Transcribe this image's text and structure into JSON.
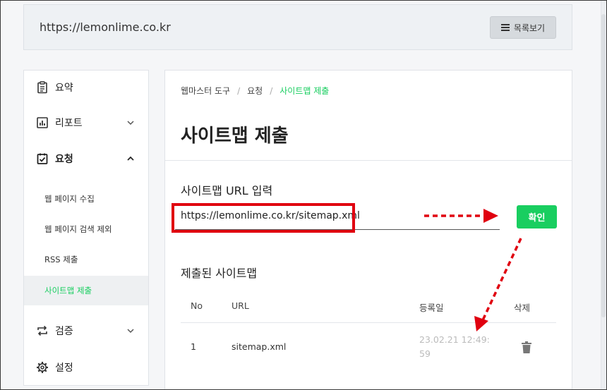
{
  "topbar": {
    "site_url": "https://lemonlime.co.kr",
    "list_button_label": "목록보기"
  },
  "sidebar": {
    "items": [
      {
        "label": "요약",
        "icon": "clipboard-icon"
      },
      {
        "label": "리포트",
        "icon": "chart-icon"
      },
      {
        "label": "요청",
        "icon": "check-clipboard-icon"
      },
      {
        "label": "검증",
        "icon": "repeat-icon"
      },
      {
        "label": "설정",
        "icon": "gear-icon"
      }
    ],
    "sub_items": [
      {
        "label": "웹 페이지 수집"
      },
      {
        "label": "웹 페이지 검색 제외"
      },
      {
        "label": "RSS 제출"
      },
      {
        "label": "사이트맵 제출"
      }
    ]
  },
  "main": {
    "breadcrumb": [
      "웹마스터 도구",
      "요청",
      "사이트맵 제출"
    ],
    "title": "사이트맵 제출",
    "url_section_label": "사이트맵 URL 입력",
    "url_value": "https://lemonlime.co.kr/sitemap.xml",
    "confirm_label": "확인",
    "submitted_label": "제출된 사이트맵",
    "table": {
      "headers": [
        "No",
        "URL",
        "등록일",
        "삭제"
      ],
      "rows": [
        {
          "no": "1",
          "url": "sitemap.xml",
          "date_line1": "23.02.21 12:49:",
          "date_line2": "59"
        }
      ]
    }
  },
  "colors": {
    "accent_green": "#19ce60",
    "annotation_red": "#e0000f"
  }
}
